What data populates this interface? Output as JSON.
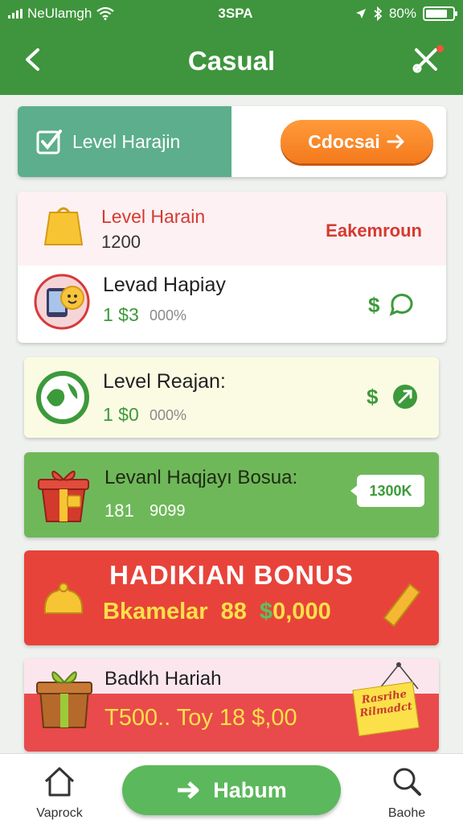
{
  "status_bar": {
    "carrier": "NeUlamgh",
    "time": "3SPA",
    "battery": "80%",
    "battery_level": 0.8
  },
  "header": {
    "title": "Casual"
  },
  "banner": {
    "label": "Level Harajin",
    "button_label": "Cdocsai"
  },
  "cards": [
    {
      "title": "Level Harain",
      "value": "1200",
      "tag": "Eakemroun",
      "sub_title": "Levad Hapiay",
      "sub_amount": "1 $3",
      "sub_percent": "000%"
    },
    {
      "title": "Level Reajan:",
      "amount": "1 $0",
      "percent": "000%"
    },
    {
      "title": "Levanl Haqjayı Bosua:",
      "amount": "181",
      "secondary": "9099",
      "badge": "1300K"
    },
    {
      "title": "HADIKIAN BONUS",
      "subtitle_text": "Bkamelar",
      "subtitle_num": "88",
      "subtitle_dollar": "$",
      "subtitle_value": "0,000"
    },
    {
      "title": "Badkh Hariah",
      "line": "T500.. Toy 18 $,00",
      "sign": "Rasrihe Rilmadct"
    }
  ],
  "bottom_nav": {
    "home_label": "Vaprock",
    "main_button": "Habum",
    "search_label": "Baohe"
  },
  "colors": {
    "primary_green": "#3e953d",
    "orange_cta": "#f47a1c",
    "bonus_red": "#e8433a"
  }
}
